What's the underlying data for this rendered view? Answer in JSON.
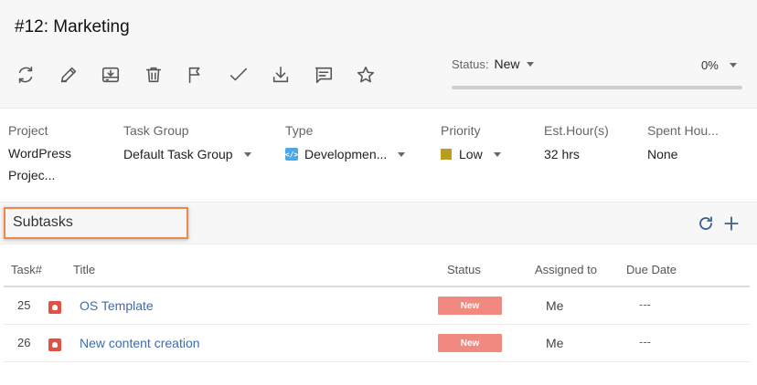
{
  "header": {
    "title": "#12: Marketing",
    "toolbar": [
      {
        "name": "refresh-icon",
        "tooltip": "Refresh"
      },
      {
        "name": "edit-icon",
        "tooltip": "Edit"
      },
      {
        "name": "save-icon",
        "tooltip": "Save"
      },
      {
        "name": "delete-icon",
        "tooltip": "Delete"
      },
      {
        "name": "flag-icon",
        "tooltip": "Flag"
      },
      {
        "name": "check-icon",
        "tooltip": "Complete"
      },
      {
        "name": "download-icon",
        "tooltip": "Download"
      },
      {
        "name": "comment-icon",
        "tooltip": "Comment"
      },
      {
        "name": "star-icon",
        "tooltip": "Star"
      }
    ],
    "status_label": "Status:",
    "status_value": "New",
    "progress_label": "0%",
    "progress_fraction": 0.0
  },
  "fields": {
    "project": {
      "label": "Project",
      "value": "WordPress Projec..."
    },
    "task_group": {
      "label": "Task Group",
      "value": "Default Task Group"
    },
    "type": {
      "label": "Type",
      "value": "Developmen...",
      "icon": "code-icon"
    },
    "priority": {
      "label": "Priority",
      "value": "Low",
      "color": "#b89d1f"
    },
    "est_hours": {
      "label": "Est.Hour(s)",
      "value": "32 hrs"
    },
    "spent_hours": {
      "label": "Spent Hou...",
      "value": "None"
    }
  },
  "subtasks": {
    "title": "Subtasks",
    "columns": {
      "task": "Task#",
      "title": "Title",
      "status": "Status",
      "assigned": "Assigned to",
      "due": "Due Date"
    },
    "rows": [
      {
        "num": "25",
        "title": "OS Template",
        "status": "New",
        "assigned": "Me",
        "due": "---"
      },
      {
        "num": "26",
        "title": "New content creation",
        "status": "New",
        "assigned": "Me",
        "due": "---"
      }
    ]
  },
  "colors": {
    "accent": "#4a7fc1",
    "link": "#3d6cb0",
    "status_new": "#f08a80",
    "bug": "#e25144",
    "highlight_border": "#f0884a"
  }
}
